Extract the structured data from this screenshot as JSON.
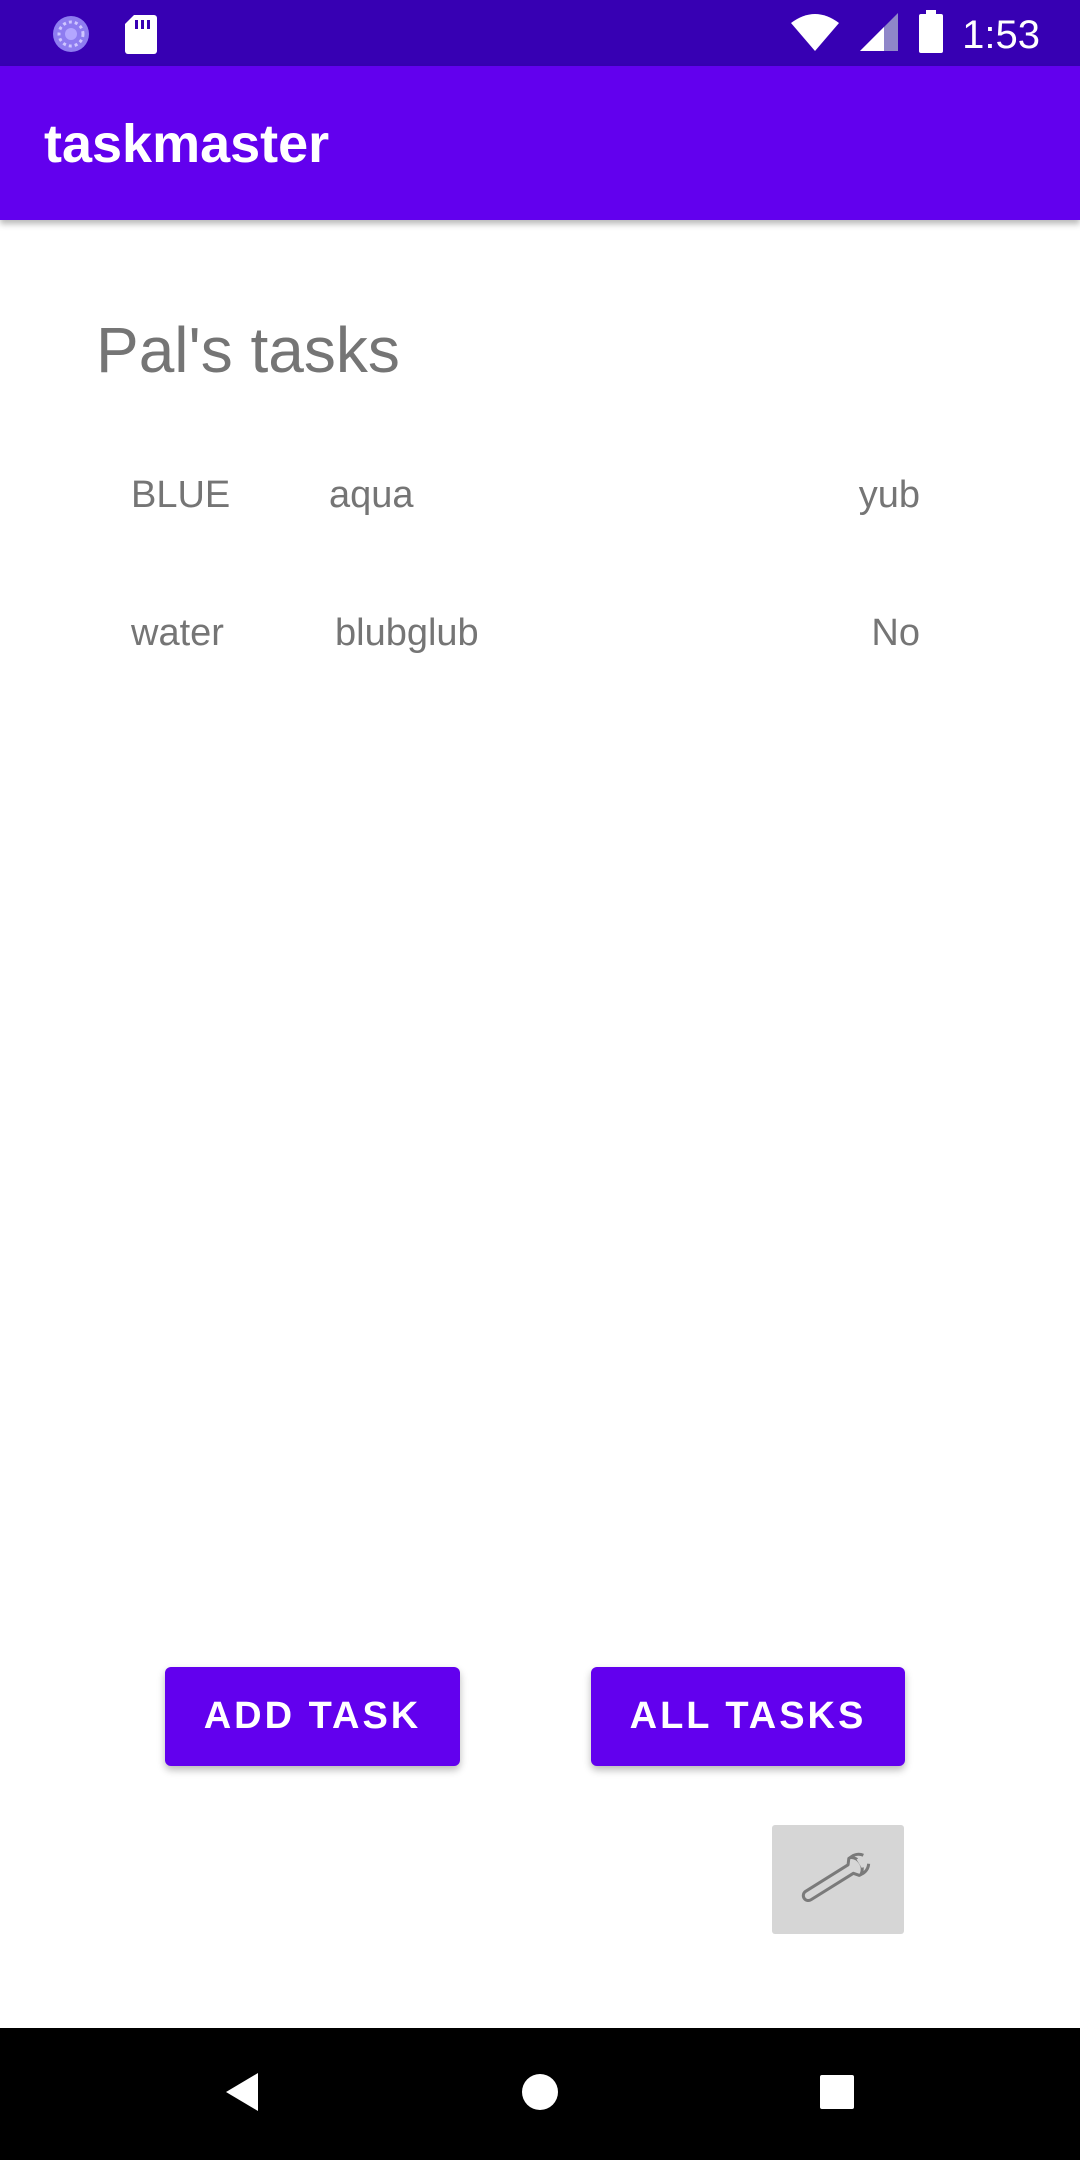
{
  "status_bar": {
    "time": "1:53",
    "left_icons": [
      "sync-icon",
      "sd-card-icon"
    ],
    "right_icons": [
      "wifi-icon",
      "cellular-signal-icon",
      "battery-icon"
    ]
  },
  "app_bar": {
    "title": "taskmaster"
  },
  "page": {
    "title": "Pal's tasks"
  },
  "tasks": [
    {
      "title": "BLUE",
      "body": "aqua",
      "state": "yub"
    },
    {
      "title": "water",
      "body": "blubglub",
      "state": "No"
    }
  ],
  "buttons": {
    "add_task": "ADD TASK",
    "all_tasks": "ALL TASKS",
    "settings_icon": "wrench-icon"
  },
  "nav_bar": {
    "icons": [
      "back-icon",
      "home-icon",
      "recents-icon"
    ]
  },
  "colors": {
    "status_bar": "#3700b3",
    "app_bar": "#6200ee",
    "button": "#6200ee",
    "text_gray": "#757575",
    "settings_button": "#d6d6d6",
    "nav_bar": "#000000"
  }
}
